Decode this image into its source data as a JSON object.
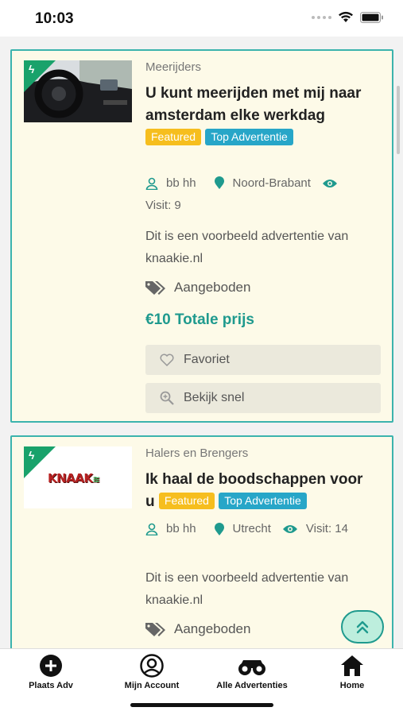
{
  "status": {
    "time": "10:03"
  },
  "listings": [
    {
      "category": "Meerijders",
      "title": "U kunt meerijden met mij naar amsterdam elke werkdag",
      "badge_featured": "Featured",
      "badge_top": "Top Advertentie",
      "user": "bb hh",
      "location": "Noord-Brabant",
      "visit": "Visit: 9",
      "description": "Dit is een voorbeeld advertentie van knaakie.nl",
      "offer": "Aangeboden",
      "price": "€10 Totale prijs",
      "fav_label": "Favoriet",
      "quick_label": "Bekijk snel"
    },
    {
      "category": "Halers en Brengers",
      "title": "Ik haal de boodschappen voor u",
      "badge_featured": "Featured",
      "badge_top": "Top Advertentie",
      "user": "bb hh",
      "location": "Utrecht",
      "visit": "Visit: 14",
      "description": "Dit is een voorbeeld advertentie van knaakie.nl",
      "offer": "Aangeboden",
      "logo_text": "KNAAK"
    }
  ],
  "tabs": [
    {
      "label": "Plaats Adv",
      "icon": "plus-circle-icon"
    },
    {
      "label": "Mijn Account",
      "icon": "user-circle-icon"
    },
    {
      "label": "Alle Advertenties",
      "icon": "binoculars-icon"
    },
    {
      "label": "Home",
      "icon": "home-icon"
    }
  ],
  "colors": {
    "accent": "#1f9a8e",
    "card_bg": "#fdfae8",
    "featured": "#f6be1e",
    "top": "#27a6c8"
  }
}
